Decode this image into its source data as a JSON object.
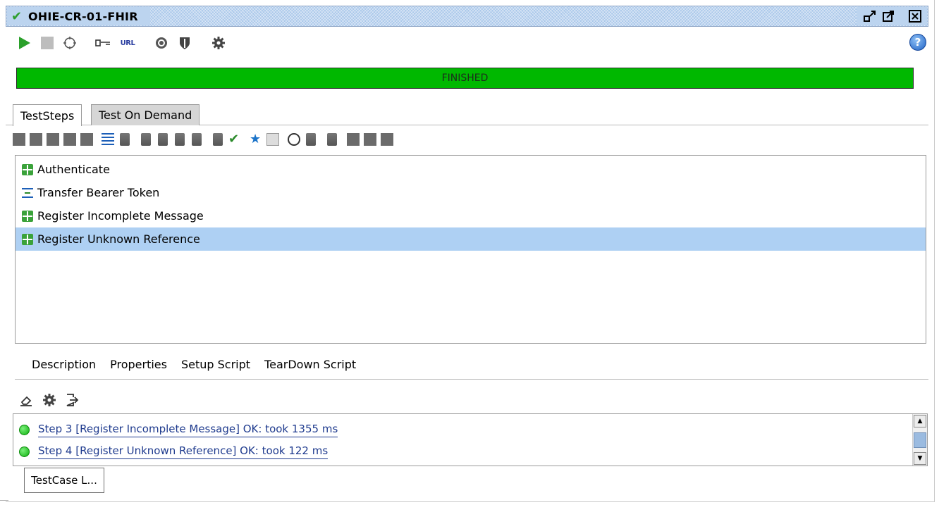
{
  "window": {
    "title": "OHIE-CR-01-FHIR"
  },
  "toolbar": {
    "items": [
      "play-icon",
      "stop-icon",
      "loop-icon",
      "key-icon",
      "url-icon",
      "target-icon",
      "shield-icon",
      "gear-icon"
    ],
    "url_label": "URL",
    "help_label": "?"
  },
  "progress": {
    "status": "FINISHED",
    "fraction": 1.0,
    "color": "#00b800"
  },
  "tabs": [
    {
      "label": "TestSteps",
      "active": true
    },
    {
      "label": "Test On Demand",
      "active": false
    }
  ],
  "steps": [
    {
      "label": "Authenticate",
      "icon": "rest-step-icon",
      "selected": false
    },
    {
      "label": "Transfer Bearer Token",
      "icon": "property-transfer-icon",
      "selected": false
    },
    {
      "label": "Register Incomplete Message",
      "icon": "rest-step-icon",
      "selected": false
    },
    {
      "label": "Register Unknown Reference",
      "icon": "rest-step-icon",
      "selected": true
    }
  ],
  "subtabs": [
    "Description",
    "Properties",
    "Setup Script",
    "TearDown Script"
  ],
  "log": {
    "lines": [
      "Step 3 [Register Incomplete Message] OK: took 1355 ms",
      "Step 4 [Register Unknown Reference] OK: took 122 ms"
    ]
  },
  "footer": {
    "button_label": "TestCase L..."
  },
  "colors": {
    "accent_green": "#00b800",
    "selection": "#aed0f3",
    "title_bar": "#a9c7ea"
  }
}
